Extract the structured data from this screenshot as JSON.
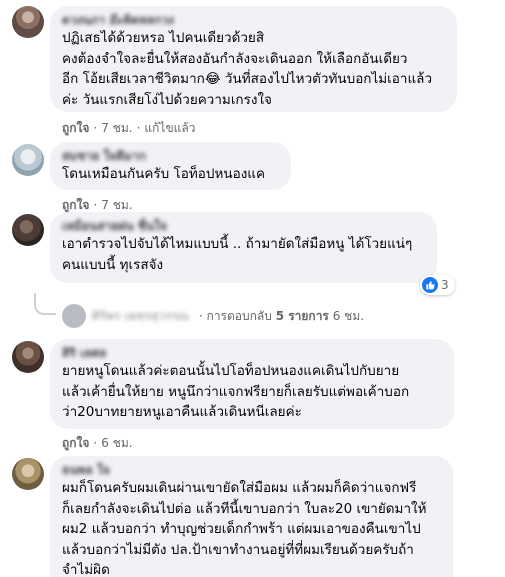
{
  "comments": [
    {
      "author": "ดวงนภา อ๊ะคิดหลกวง",
      "text": "ปฏิเสธได้ด้วยหรอ ไปคนเดียวด้วยสิ\nคงต้องจำใจละยื่นให้สองอันกำลังจะเดินออก ให้เลือกอันเดียว\nอีก โอ้ยเสียเวลาชีวิตมาก😂 วันที่สองไปไหวตัวทันบอกไม่เอาแล้ว\nค่ะ วันแรกเสียโง่ไปด้วยความเกรงใจ",
      "like": "ถูกใจ",
      "time": "7 ชม.",
      "edited": "แก้ไขแล้ว"
    },
    {
      "author": "สมชาย ใจดีมาก",
      "text": "โดนเหมือนกันครับ โอท็อปหนองแค",
      "like": "ถูกใจ",
      "time": "7 ชม."
    },
    {
      "author": "เหมือนสายฝน ชื่นใจ",
      "text": "เอาตำรวจไปจับได้ไหมแบบนี้ .. ถ้ามายัดใส่มือหนู ได้โวยแน่ๆ\nคนแบบนี้ ทุเรสจัง",
      "reaction_count": "3",
      "reply_author": "ศิริพร เพชรสุวรรณ",
      "reply_prefix": "· การตอบกลับ",
      "reply_count": "5 รายการ",
      "reply_time": "6 ชม."
    },
    {
      "author": "สิริ เลศล",
      "text": "ยายหนูโดนแล้วค่ะตอนนั้นไปโอท็อปหนองแคเดินไปกับยาย\nแล้วเค้ายื่นให้ยาย หนูนึกว่าแจกฟรียายก็เลยรับแต่พอเค้าบอก\nว่า20บาทยายหนูเอาคืนแล้วเดินหนีเลยค่ะ",
      "like": "ถูกใจ",
      "time": "6 ชม."
    },
    {
      "author": "ธนพล ใจ",
      "text": "ผมก็โดนครับผมเดินผ่านเขายัดใส่มือผม แล้วผมก็คิดว่าแจกฟรี\nก็เลยกำลังจะเดินไปต่อ แล้วทีนี้เขาบอกว่า ใบละ20 เขายัดมาให้\nผม2 แล้วบอกว่า ทำบุญช่วยเด็กกำพร้า แต่ผมเอาของคืนเขาไป\nแล้วบอกว่าไม่มีตัง ปล.ป้าเขาทำงานอยู่ที่ที่ผมเรียนด้วยครับถ้า\nจำไม่ผิด"
    }
  ],
  "colors": {
    "bubble": "#f0f2f5",
    "meta": "#65676b",
    "like_icon": "#1877f2"
  },
  "icons": {
    "reaction": "thumbs-up-icon"
  }
}
